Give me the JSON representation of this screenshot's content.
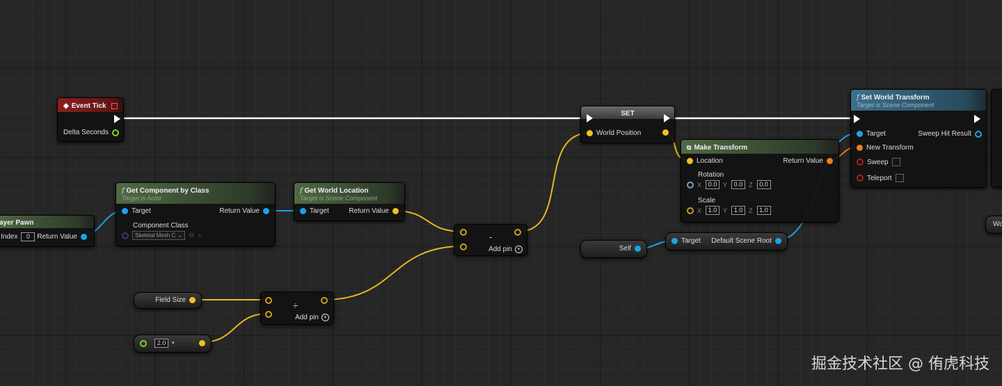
{
  "nodes": {
    "event_tick": {
      "title": "Event Tick",
      "delta_seconds": "Delta Seconds"
    },
    "player_pawn": {
      "title": "ayer Pawn",
      "index_label": "Index",
      "index_value": "0",
      "return_value": "Return Value"
    },
    "get_component": {
      "title": "Get Component by Class",
      "subtitle": "Target is Actor",
      "target": "Target",
      "return_value": "Return Value",
      "component_class": "Component Class",
      "class_value": "Skeletal Mesh C"
    },
    "get_world_location": {
      "title": "Get World Location",
      "subtitle": "Target is Scene Component",
      "target": "Target",
      "return_value": "Return Value"
    },
    "set_node": {
      "title": "SET",
      "world_position": "World Position"
    },
    "subtract": {
      "op": "-",
      "add_pin": "Add pin"
    },
    "field_size": {
      "label": "Field Size"
    },
    "divide": {
      "op": "÷",
      "add_pin": "Add pin"
    },
    "float_literal": {
      "value": "2.0"
    },
    "make_transform": {
      "title": "Make Transform",
      "location": "Location",
      "return_value": "Return Value",
      "rotation": "Rotation",
      "rotation_x": "0.0",
      "rotation_y": "0.0",
      "rotation_z": "0.0",
      "scale": "Scale",
      "scale_x": "1.0",
      "scale_y": "1.0",
      "scale_z": "1.0",
      "axis_x": "X",
      "axis_y": "Y",
      "axis_z": "Z"
    },
    "self_node": {
      "label": "Self"
    },
    "default_scene_root": {
      "target": "Target",
      "label": "Default Scene Root"
    },
    "set_world_transform": {
      "title": "Set World Transform",
      "subtitle": "Target is Scene Component",
      "target": "Target",
      "sweep_hit_result": "Sweep Hit Result",
      "new_transform": "New Transform",
      "sweep": "Sweep",
      "teleport": "Teleport"
    },
    "edge_node": {
      "label": "Wo"
    }
  },
  "watermark": "掘金技术社区 @ 侑虎科技",
  "colors": {
    "background": "#262626",
    "exec_wire": "#ffffff",
    "vector_wire": "#f0c020",
    "object_wire": "#1aa3e8",
    "transform_wire": "#f07d1a"
  }
}
